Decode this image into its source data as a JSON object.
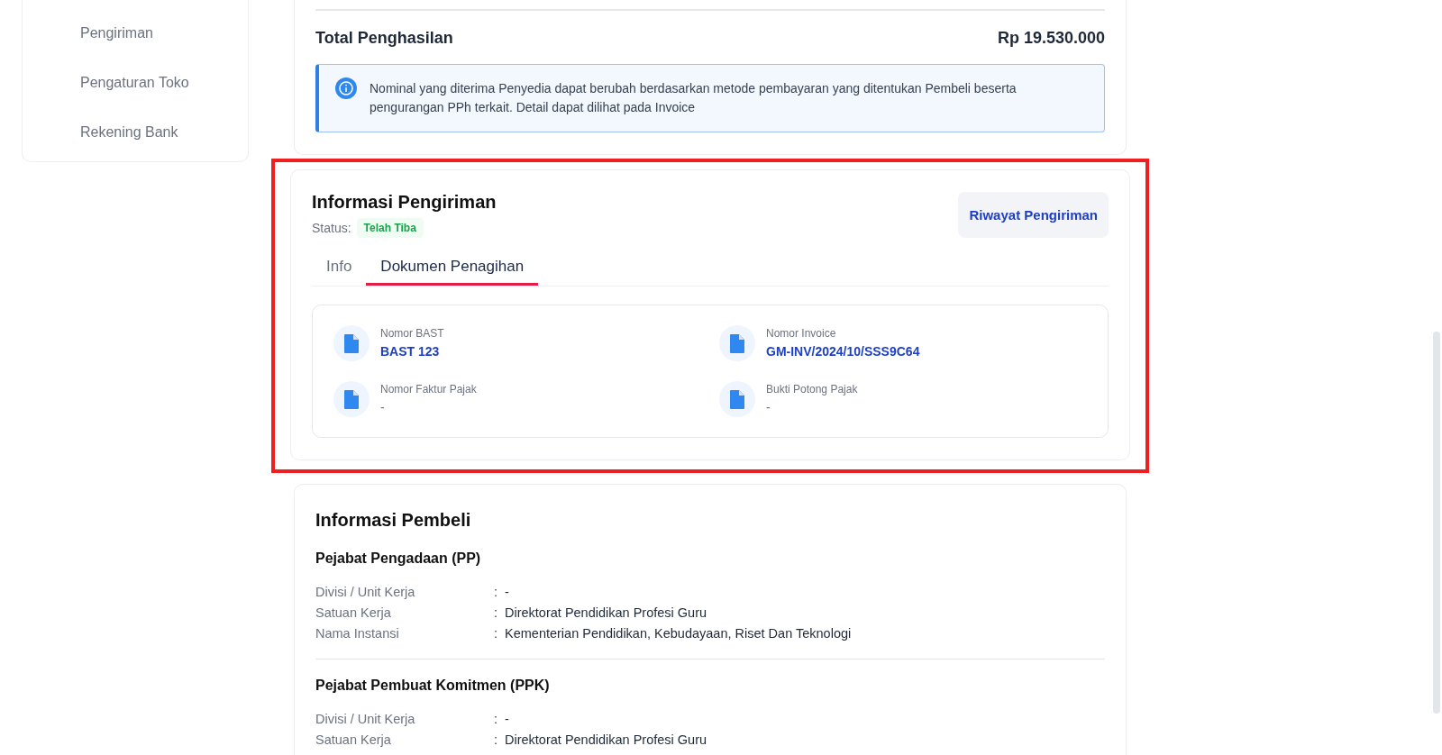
{
  "sidebar": {
    "items": [
      {
        "label": "Pengiriman"
      },
      {
        "label": "Pengaturan Toko"
      },
      {
        "label": "Rekening Bank"
      }
    ]
  },
  "earnings": {
    "label": "Total Penghasilan",
    "amount": "Rp 19.530.000",
    "notice": "Nominal yang diterima Penyedia dapat berubah berdasarkan metode pembayaran yang ditentukan Pembeli beserta pengurangan PPh terkait. Detail dapat dilihat pada Invoice"
  },
  "shipping": {
    "title": "Informasi Pengiriman",
    "status_label": "Status:",
    "status": "Telah Tiba",
    "history_button": "Riwayat Pengiriman",
    "tabs": [
      {
        "label": "Info",
        "selected": false
      },
      {
        "label": "Dokumen Penagihan",
        "selected": true
      }
    ],
    "documents": [
      {
        "label": "Nomor BAST",
        "value": "BAST 123",
        "kind": "link"
      },
      {
        "label": "Nomor Invoice",
        "value": "GM-INV/2024/10/SSS9C64",
        "kind": "link"
      },
      {
        "label": "Nomor Faktur Pajak",
        "value": "-",
        "kind": "plain"
      },
      {
        "label": "Bukti Potong Pajak",
        "value": "-",
        "kind": "plain"
      }
    ]
  },
  "buyer": {
    "title": "Informasi Pembeli",
    "sections": [
      {
        "title": "Pejabat Pengadaan (PP)",
        "rows": [
          {
            "label": "Divisi / Unit Kerja",
            "separator": ":",
            "value": "-"
          },
          {
            "label": "Satuan Kerja",
            "separator": ":",
            "value": "Direktorat Pendidikan Profesi Guru"
          },
          {
            "label": "Nama Instansi",
            "separator": ":",
            "value": "Kementerian Pendidikan, Kebudayaan, Riset Dan Teknologi"
          }
        ]
      },
      {
        "title": "Pejabat Pembuat Komitmen (PPK)",
        "rows": [
          {
            "label": "Divisi / Unit Kerja",
            "separator": ":",
            "value": "-"
          },
          {
            "label": "Satuan Kerja",
            "separator": ":",
            "value": "Direktorat Pendidikan Profesi Guru"
          }
        ]
      }
    ]
  }
}
